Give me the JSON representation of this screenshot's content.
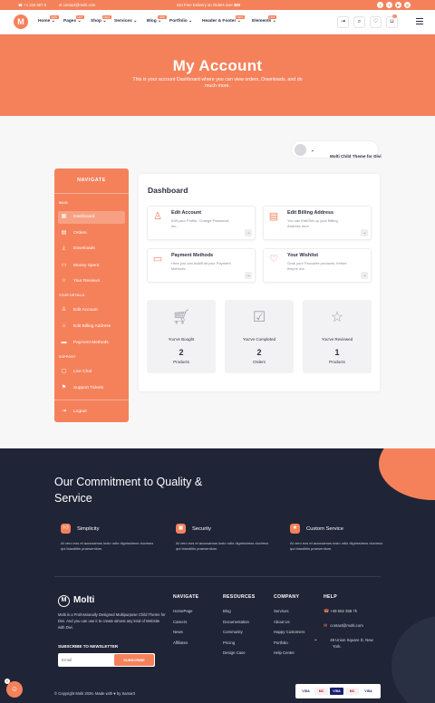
{
  "topbar": {
    "phone": "+1 234 567 8",
    "email": "contact@molti.com",
    "promo_prefix": "Get Free Delivery on Orders over",
    "promo_amount": "$60",
    "social_icons": [
      "facebook-icon",
      "twitter-icon",
      "youtube-icon",
      "instagram-icon"
    ]
  },
  "nav": {
    "logo_letter": "M",
    "menu": [
      {
        "label": "Home",
        "badge": "NEW"
      },
      {
        "label": "Pages",
        "badge": "HOT"
      },
      {
        "label": "Shop",
        "badge": "NEW"
      },
      {
        "label": "Services",
        "badge": ""
      },
      {
        "label": "Blog",
        "badge": "NEW"
      },
      {
        "label": "Portfolio",
        "badge": ""
      },
      {
        "label": "Header & Footer",
        "badge": "NEW"
      },
      {
        "label": "Elements",
        "badge": "HOT"
      }
    ],
    "cart_count": "0"
  },
  "hero": {
    "title": "My Account",
    "subtitle": "This is your account Dashboard where you can view orders, Downloads, and do much more."
  },
  "account_dropdown": {
    "label": "Molti Child Theme for Divi"
  },
  "sidebar": {
    "title": "NAVIGATE",
    "sections": {
      "main": "MAIN",
      "details": "YOUR DETAILS",
      "support": "SUPPORT"
    },
    "items": [
      {
        "label": "Dashboard",
        "icon": "grid-icon"
      },
      {
        "label": "Orders",
        "icon": "receipt-icon"
      },
      {
        "label": "Downloads",
        "icon": "download-icon"
      },
      {
        "label": "Money Spent",
        "icon": "wallet-icon"
      },
      {
        "label": "Your Reviews",
        "icon": "star-icon"
      },
      {
        "label": "Edit Account",
        "icon": "user-icon"
      },
      {
        "label": "Edit Billing Address",
        "icon": "home-icon"
      },
      {
        "label": "Payment Methods",
        "icon": "card-icon"
      },
      {
        "label": "Live Chat",
        "icon": "chat-icon"
      },
      {
        "label": "Support Tickets",
        "icon": "ticket-icon"
      },
      {
        "label": "Logout",
        "icon": "logout-icon"
      }
    ]
  },
  "dashboard": {
    "title": "Dashboard",
    "cards": [
      {
        "title": "Edit Account",
        "desc": "Edit your Profile, Change Password, etc."
      },
      {
        "title": "Edit Billing Address",
        "desc": "You can Edit/Set up your Billing Address here."
      },
      {
        "title": "Payment Methods",
        "desc": "Here you can Add/Edit your Payment Methods."
      },
      {
        "title": "Your Wishlist",
        "desc": "Grab your Favourite products, before they're out."
      }
    ],
    "stats": [
      {
        "label": "You've Bought",
        "value": "2",
        "unit": "Products"
      },
      {
        "label": "You've Completed",
        "value": "2",
        "unit": "Orders"
      },
      {
        "label": "You've Reviewed",
        "value": "1",
        "unit": "Products"
      }
    ]
  },
  "footer": {
    "commitment": "Our Commitment to Quality & Service",
    "features": [
      {
        "title": "Simplicity",
        "desc": "At vero eos et accusamus iusto odio dignissimos ducimus qui blanditiis praesentium."
      },
      {
        "title": "Security",
        "desc": "At vero eos et accusamus iusto odio dignissimos ducimus qui blanditiis praesentium."
      },
      {
        "title": "Custom Service",
        "desc": "At vero eos et accusamus iusto odio dignissimos ducimus qui blanditiis praesentium."
      }
    ],
    "brand": "Molti",
    "about": "Molti is a Professionally Designed Multipurpose Child Theme for Divi. And you can use it to create almost any kind of Website with Divi.",
    "newsletter_title": "SUBSCRIBE TO NEWSLETTER",
    "email_placeholder": "Email",
    "subscribe_label": "SUBSCRIBE",
    "columns": [
      {
        "title": "NAVIGATE",
        "items": [
          "HomePage",
          "Careers",
          "News",
          "Affiliates"
        ]
      },
      {
        "title": "RESOURCES",
        "items": [
          "Blog",
          "Documentation",
          "Community",
          "Pricing",
          "Design Case"
        ]
      },
      {
        "title": "COMPANY",
        "items": [
          "Services",
          "About Us",
          "Happy Customers",
          "Portfolio",
          "Help Center"
        ]
      }
    ],
    "help": {
      "title": "HELP",
      "phone": "+49 692 358 7k",
      "email": "contact@molti.com",
      "address": "49 Union Square D, New York."
    },
    "copyright": "© Copyright Molti 2026. Made with ♥ by Samar3",
    "payments": [
      "VISA",
      "MC",
      "VISA",
      "MC",
      "VISA"
    ]
  },
  "colors": {
    "accent": "#f5815b",
    "footer_bg": "#1f2436",
    "text": "#2a3042"
  }
}
